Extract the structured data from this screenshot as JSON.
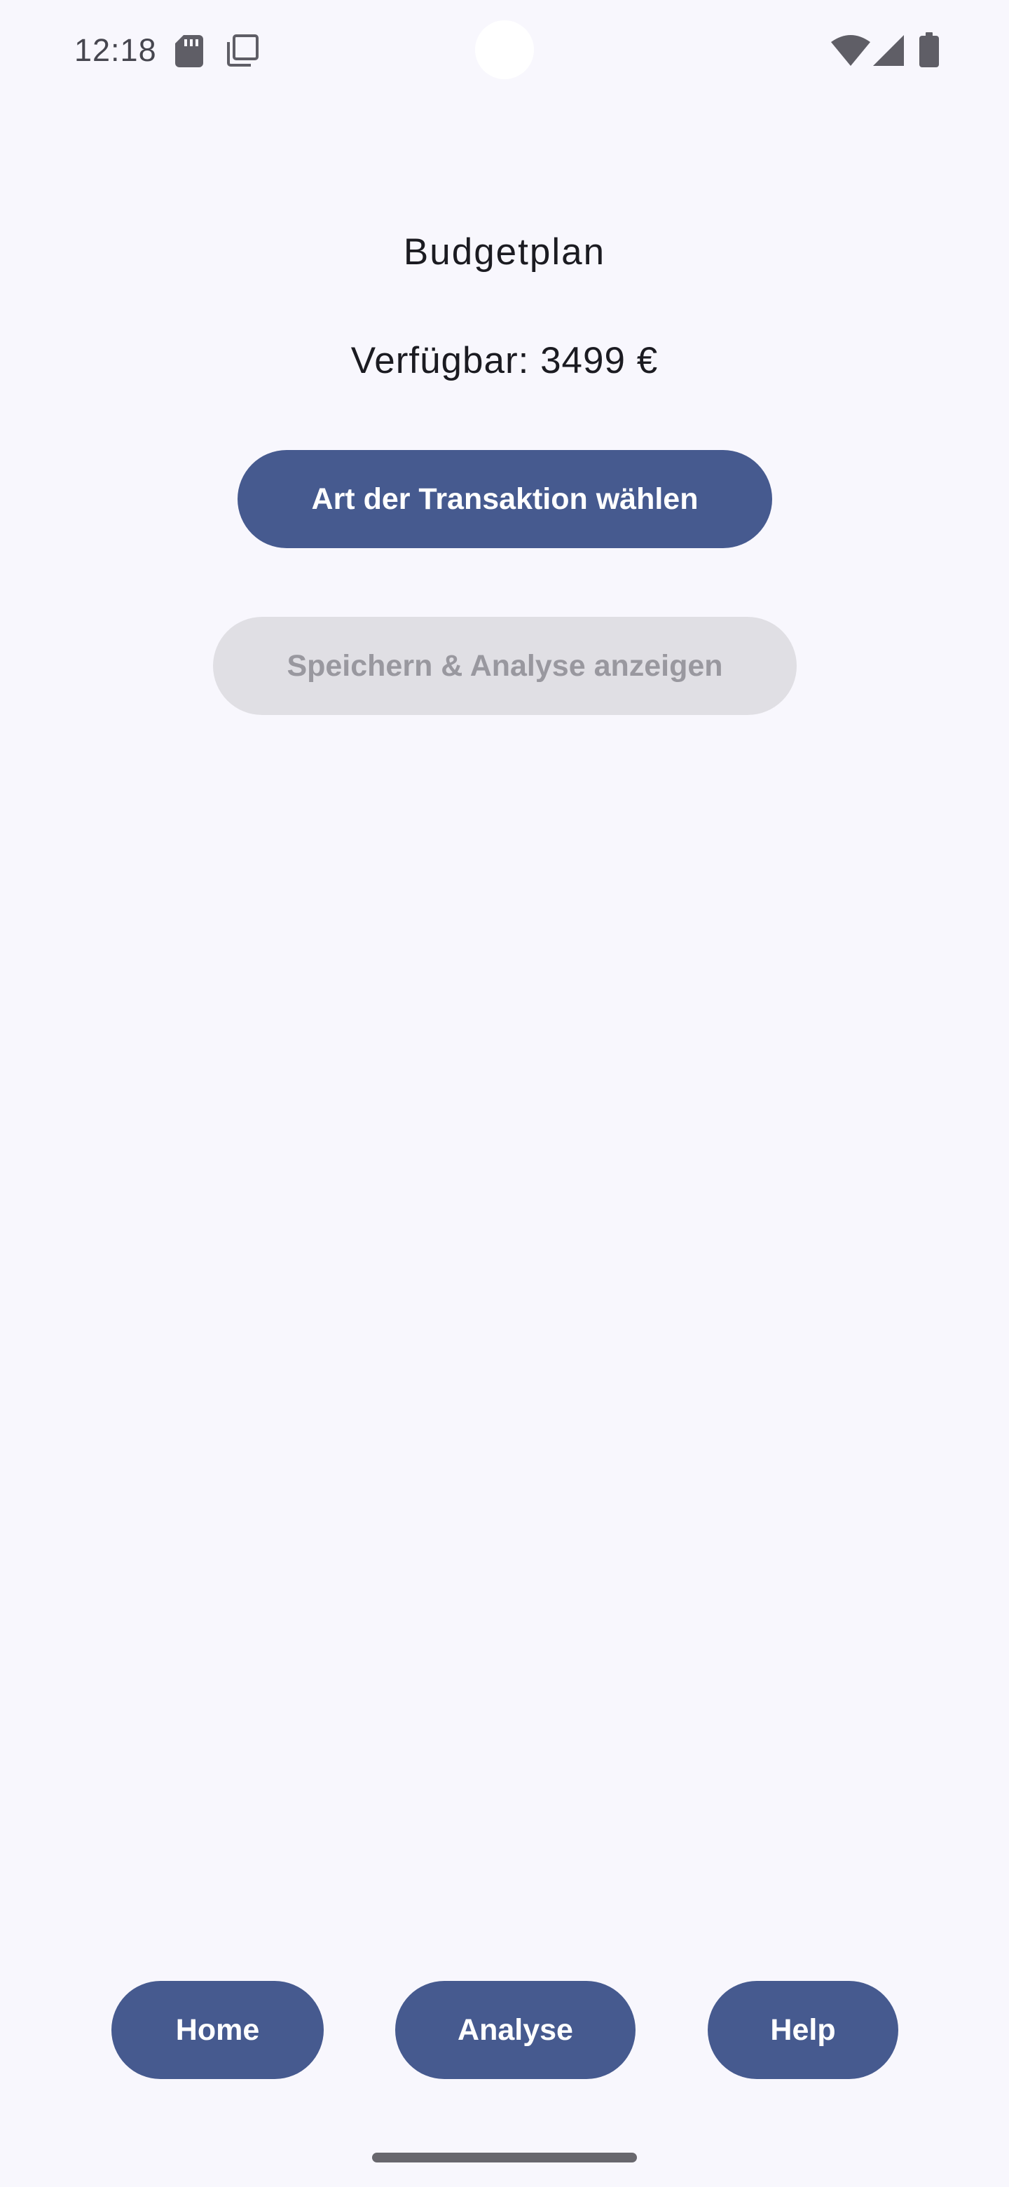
{
  "status_bar": {
    "time": "12:18",
    "icons": [
      "sd-card-icon",
      "screenshot-icon",
      "wifi-icon",
      "cell-signal-icon",
      "battery-icon"
    ]
  },
  "main": {
    "title": "Budgetplan",
    "available": "Verfügbar: 3499 €",
    "choose_transaction_label": "Art der Transaktion wählen",
    "save_analyze_label": "Speichern & Analyse anzeigen"
  },
  "bottom_nav": {
    "home_label": "Home",
    "analyse_label": "Analyse",
    "help_label": "Help"
  },
  "colors": {
    "background": "#f8f7fd",
    "primary": "#465a8f",
    "disabled_bg": "#e0dfe4",
    "disabled_text": "#99989f"
  }
}
